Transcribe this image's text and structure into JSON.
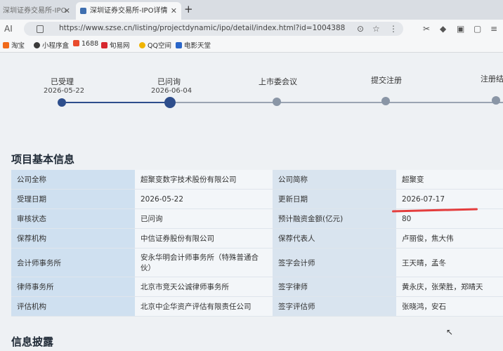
{
  "browser": {
    "tabs": [
      {
        "label": "深圳证券交易所-IPO"
      },
      {
        "label": "深圳证券交易所-IPO详情"
      }
    ],
    "new_tab": "+",
    "url": "https://www.szse.cn/listing/projectdynamic/ipo/detail/index.html?id=1004388",
    "bookmarks": [
      "淘宝",
      "小程序盒",
      "1688",
      "旬易网",
      "QQ空间",
      "电影天堂"
    ],
    "bookmark_colors": [
      "#f06a1a",
      "#3a3a3a",
      "#e94b2d",
      "#d7282f",
      "#f0b400",
      "#2a66c9"
    ]
  },
  "progress": {
    "steps": [
      {
        "label": "已受理",
        "date": "2026-05-22",
        "done": true
      },
      {
        "label": "已问询",
        "date": "2026-06-04",
        "done": true
      },
      {
        "label": "上市委会议",
        "date": "",
        "done": false
      },
      {
        "label": "提交注册",
        "date": "",
        "done": false
      },
      {
        "label": "注册结",
        "date": "",
        "done": false
      }
    ]
  },
  "basic_info": {
    "title": "项目基本信息",
    "rows": [
      {
        "l1": "公司全称",
        "v1": "超聚变数字技术股份有限公司",
        "l2": "公司简称",
        "v2": "超聚变"
      },
      {
        "l1": "受理日期",
        "v1": "2026-05-22",
        "l2": "更新日期",
        "v2": "2026-07-17"
      },
      {
        "l1": "审核状态",
        "v1": "已问询",
        "l2": "预计融资金额(亿元)",
        "v2": "80"
      },
      {
        "l1": "保荐机构",
        "v1": "中信证券股份有限公司",
        "l2": "保荐代表人",
        "v2": "卢丽俊，焦大伟"
      },
      {
        "l1": "会计师事务所",
        "v1": "安永华明会计师事务所（特殊普通合伙）",
        "l2": "签字会计师",
        "v2": "王天晴，孟冬"
      },
      {
        "l1": "律师事务所",
        "v1": "北京市竞天公诚律师事务所",
        "l2": "签字律师",
        "v2": "黄永庆，张荣胜，郑晴天"
      },
      {
        "l1": "评估机构",
        "v1": "北京中企华资产评估有限责任公司",
        "l2": "签字评估师",
        "v2": "张晓鸿，安石"
      }
    ]
  },
  "disclosure": {
    "title": "信息披露"
  },
  "colors": {
    "accent": "#2e4e8c",
    "pending": "#8a96a6",
    "annotation": "#e43d3d",
    "link": "#2d5aa8"
  }
}
